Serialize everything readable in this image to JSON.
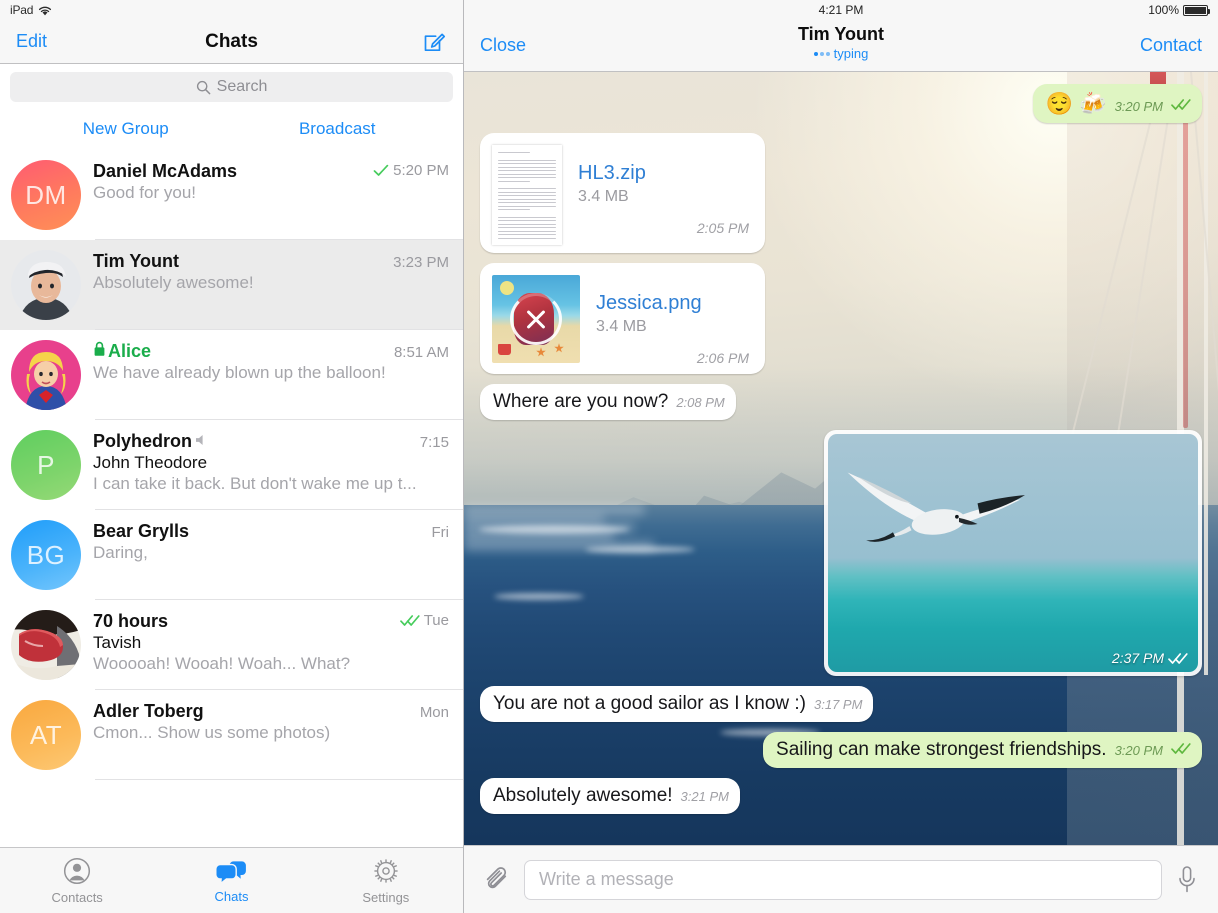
{
  "left_panel": {
    "status_bar": {
      "device": "iPad",
      "wifi_icon": "wifi-icon"
    },
    "nav": {
      "edit_label": "Edit",
      "title": "Chats",
      "compose_icon": "compose-icon"
    },
    "search": {
      "placeholder": "Search",
      "icon": "search-icon"
    },
    "quick_actions": [
      {
        "label": "New Group",
        "name": "new-group-button"
      },
      {
        "label": "Broadcast",
        "name": "broadcast-button"
      }
    ],
    "chats": [
      {
        "name": "Daniel McAdams",
        "message": "Good for you!",
        "time": "5:20 PM",
        "status_icon": "single-check",
        "avatar_type": "initials",
        "initials": "DM",
        "avatar_class": "av-dm",
        "selected": false,
        "secret": false,
        "muted": false
      },
      {
        "name": "Tim Yount",
        "message": "Absolutely awesome!",
        "time": "3:23 PM",
        "status_icon": "none",
        "avatar_type": "photo-person",
        "initials": "",
        "avatar_class": "av-tim",
        "selected": true,
        "secret": false,
        "muted": false
      },
      {
        "name": "Alice",
        "message": "We have already blown up the balloon!",
        "time": "8:51 AM",
        "status_icon": "none",
        "avatar_type": "photo-supergirl",
        "initials": "",
        "avatar_class": "av-alice",
        "selected": false,
        "secret": true,
        "muted": false
      },
      {
        "name": "Polyhedron",
        "sender": "John Theodore",
        "message": "I can take it back. But don't wake me up t...",
        "time": "7:15",
        "status_icon": "none",
        "avatar_type": "initials",
        "initials": "P",
        "avatar_class": "av-p",
        "selected": false,
        "secret": false,
        "muted": true
      },
      {
        "name": "Bear Grylls",
        "message": "Daring,",
        "time": "Fri",
        "status_icon": "none",
        "avatar_type": "initials",
        "initials": "BG",
        "avatar_class": "av-bg",
        "selected": false,
        "secret": false,
        "muted": false
      },
      {
        "name": "70 hours",
        "sender": "Tavish",
        "message": "Wooooah! Wooah! Woah... What?",
        "time": "Tue",
        "status_icon": "double-check",
        "avatar_type": "photo-heartbox",
        "initials": "",
        "avatar_class": "av-70",
        "selected": false,
        "secret": false,
        "muted": false
      },
      {
        "name": "Adler Toberg",
        "message": "Cmon... Show us some photos)",
        "time": "Mon",
        "status_icon": "none",
        "avatar_type": "initials",
        "initials": "AT",
        "avatar_class": "av-at",
        "selected": false,
        "secret": false,
        "muted": false
      }
    ],
    "tabs": [
      {
        "label": "Contacts",
        "icon": "contacts-icon",
        "active": false
      },
      {
        "label": "Chats",
        "icon": "chats-icon",
        "active": true
      },
      {
        "label": "Settings",
        "icon": "settings-gear-icon",
        "active": false
      }
    ]
  },
  "right_panel": {
    "status_bar": {
      "time": "4:21 PM",
      "battery_percent": "100%",
      "battery_icon": "battery-full-icon"
    },
    "nav": {
      "close_label": "Close",
      "title": "Tim Yount",
      "status": "typing",
      "contact_label": "Contact"
    },
    "messages": [
      {
        "kind": "emoji",
        "direction": "out",
        "text": "😌 🍻",
        "time": "3:20 PM",
        "ticks": "double-check"
      },
      {
        "kind": "file",
        "direction": "in",
        "thumb": "document-thumbnail",
        "file_name": "HL3.zip",
        "file_size": "3.4 MB",
        "time": "2:05 PM"
      },
      {
        "kind": "file-image",
        "direction": "in",
        "thumb": "beach-image-thumbnail",
        "overlay_icon": "cancel-download-icon",
        "file_name": "Jessica.png",
        "file_size": "3.4 MB",
        "time": "2:06 PM"
      },
      {
        "kind": "text",
        "direction": "in",
        "text": "Where are you now?",
        "time": "2:08 PM"
      },
      {
        "kind": "photo",
        "direction": "out",
        "alt": "seagull-flying-over-ocean",
        "time": "2:37 PM",
        "ticks": "double-check"
      },
      {
        "kind": "text",
        "direction": "in",
        "text": "You are not a good sailor as I know :)",
        "time": "3:17 PM"
      },
      {
        "kind": "text",
        "direction": "out",
        "text": "Sailing can make strongest friendships.",
        "time": "3:20 PM",
        "ticks": "double-check"
      },
      {
        "kind": "text",
        "direction": "in",
        "text": "Absolutely awesome!",
        "time": "3:21 PM"
      }
    ],
    "composer": {
      "attach_icon": "paperclip-icon",
      "placeholder": "Write a message",
      "value": "",
      "mic_icon": "microphone-icon"
    }
  },
  "colors": {
    "accent_blue": "#1c8cf6",
    "secret_green": "#1aad4b",
    "out_bubble_green": "#dff5c2",
    "in_bubble_white": "#ffffff",
    "chrome_gray": "#f7f7f7"
  }
}
